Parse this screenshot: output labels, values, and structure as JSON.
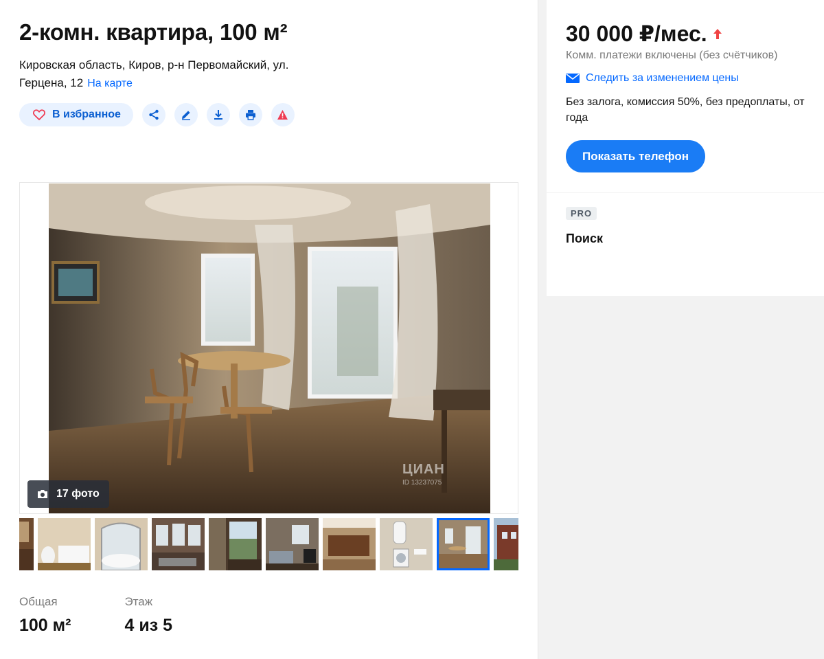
{
  "listing": {
    "title": "2-комн. квартира, 100 м²",
    "address_line1": "Кировская область, Киров, р-н Первомайский, ул.",
    "address_line2": "Герцена, 12",
    "map_link": "На карте"
  },
  "actions": {
    "favorite_label": "В избранное",
    "icons": [
      "share-icon",
      "edit-icon",
      "download-icon",
      "print-icon",
      "warning-icon"
    ]
  },
  "gallery": {
    "photo_count": "17 фото",
    "watermark": "ЦИАН",
    "watermark_id": "ID 13237075",
    "thumbnails_count": 10,
    "active_thumbnail": 8
  },
  "params": {
    "area_label": "Общая",
    "area_value": "100 м²",
    "floor_label": "Этаж",
    "floor_value": "4 из 5"
  },
  "price_card": {
    "price": "30 000 ₽/мес.",
    "utilities": "Комм. платежи включены (без счётчиков)",
    "watch_price": "Следить за изменением цены",
    "terms": "Без залога, комиссия 50%, без предоплаты, от года",
    "phone_button": "Показать телефон"
  },
  "pro_card": {
    "badge": "PRO",
    "title": "Поиск"
  },
  "colors": {
    "accent": "#0468ff",
    "price_up": "#f04343",
    "fav_bg": "#e9f2ff"
  }
}
